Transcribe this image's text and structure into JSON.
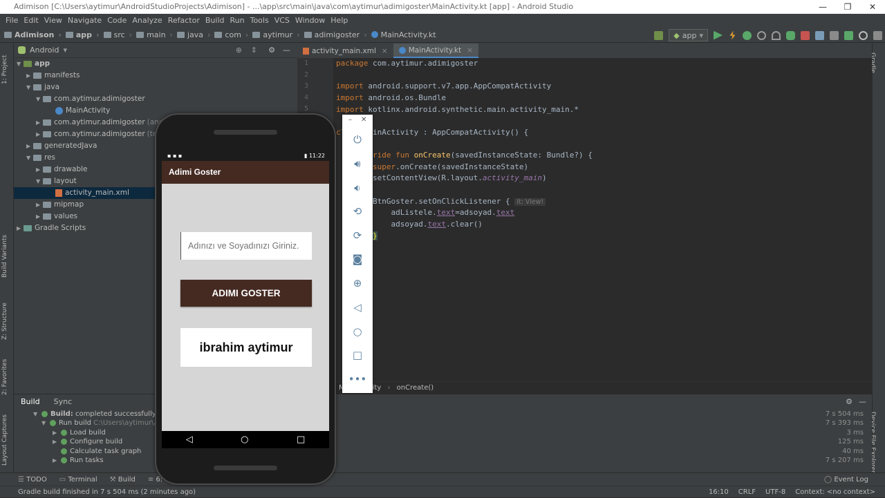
{
  "window": {
    "title": "Adimison [C:\\Users\\aytimur\\AndroidStudioProjects\\Adimison] - ...\\app\\src\\main\\java\\com\\aytimur\\adimigoster\\MainActivity.kt [app] - Android Studio"
  },
  "menu": [
    "File",
    "Edit",
    "View",
    "Navigate",
    "Code",
    "Analyze",
    "Refactor",
    "Build",
    "Run",
    "Tools",
    "VCS",
    "Window",
    "Help"
  ],
  "breadcrumbs": [
    "Adimison",
    "app",
    "src",
    "main",
    "java",
    "com",
    "aytimur",
    "adimigoster",
    "MainActivity.kt"
  ],
  "run_config": "app",
  "project_panel": {
    "view": "Android",
    "tree": [
      {
        "label": "app",
        "note": ""
      },
      {
        "label": "manifests",
        "note": ""
      },
      {
        "label": "java",
        "note": ""
      },
      {
        "label": "com.aytimur.adimigoster",
        "note": ""
      },
      {
        "label": "MainActivity",
        "note": ""
      },
      {
        "label": "com.aytimur.adimigoster",
        "note": "(androidTest)"
      },
      {
        "label": "com.aytimur.adimigoster",
        "note": "(test)"
      },
      {
        "label": "generatedJava",
        "note": ""
      },
      {
        "label": "res",
        "note": ""
      },
      {
        "label": "drawable",
        "note": ""
      },
      {
        "label": "layout",
        "note": ""
      },
      {
        "label": "activity_main.xml",
        "note": ""
      },
      {
        "label": "mipmap",
        "note": ""
      },
      {
        "label": "values",
        "note": ""
      },
      {
        "label": "Gradle Scripts",
        "note": ""
      }
    ]
  },
  "left_strip": [
    "1: Project",
    "Build Variants",
    "Z: Structure",
    "2: Favorites",
    "Layout Captures"
  ],
  "right_strip": [
    "Gradle",
    "Device File Explorer"
  ],
  "editor": {
    "tabs": [
      {
        "label": "activity_main.xml"
      },
      {
        "label": "MainActivity.kt"
      }
    ],
    "line_numbers": [
      "1",
      "2",
      "3",
      "4",
      "5"
    ],
    "hint": "it: View!",
    "breadcrumb": "MainActivity",
    "breadcrumb_fn": "onCreate()"
  },
  "build": {
    "tabs": [
      "Build",
      "Sync"
    ],
    "rows": [
      {
        "label": "Build:",
        "text": "completed successfully",
        "extra": "at",
        "time": "7 s 504 ms"
      },
      {
        "label": "Run build",
        "text": "",
        "extra": "C:\\Users\\aytimur\\An",
        "time": "7 s 393 ms"
      },
      {
        "label": "Load build",
        "text": "",
        "extra": "",
        "time": "3 ms"
      },
      {
        "label": "Configure build",
        "text": "",
        "extra": "",
        "time": "125 ms"
      },
      {
        "label": "Calculate task graph",
        "text": "",
        "extra": "",
        "time": "40 ms"
      },
      {
        "label": "Run tasks",
        "text": "",
        "extra": "",
        "time": "7 s 207 ms"
      }
    ]
  },
  "bottom_tabs": [
    "TODO",
    "Terminal",
    "Build",
    "6: Lo"
  ],
  "event_log": "Event Log",
  "status": {
    "message": "Gradle build finished in 7 s 504 ms (2 minutes ago)",
    "position": "16:10",
    "line_sep": "CRLF",
    "encoding": "UTF-8",
    "context": "Context: <no context>"
  },
  "emulator": {
    "status_time": "11:22",
    "app_title": "Adimi Goster",
    "input_placeholder": "Adınızı ve Soyadınızı Giriniz.",
    "button_label": "ADIMI GOSTER",
    "output_text": "ibrahim aytimur",
    "nav": [
      "◁",
      "○",
      "□"
    ]
  },
  "colors": {
    "app_bar": "#452a22",
    "ide_bg": "#2b2b2b",
    "panel": "#3c3f41",
    "accent": "#4a88c7"
  }
}
